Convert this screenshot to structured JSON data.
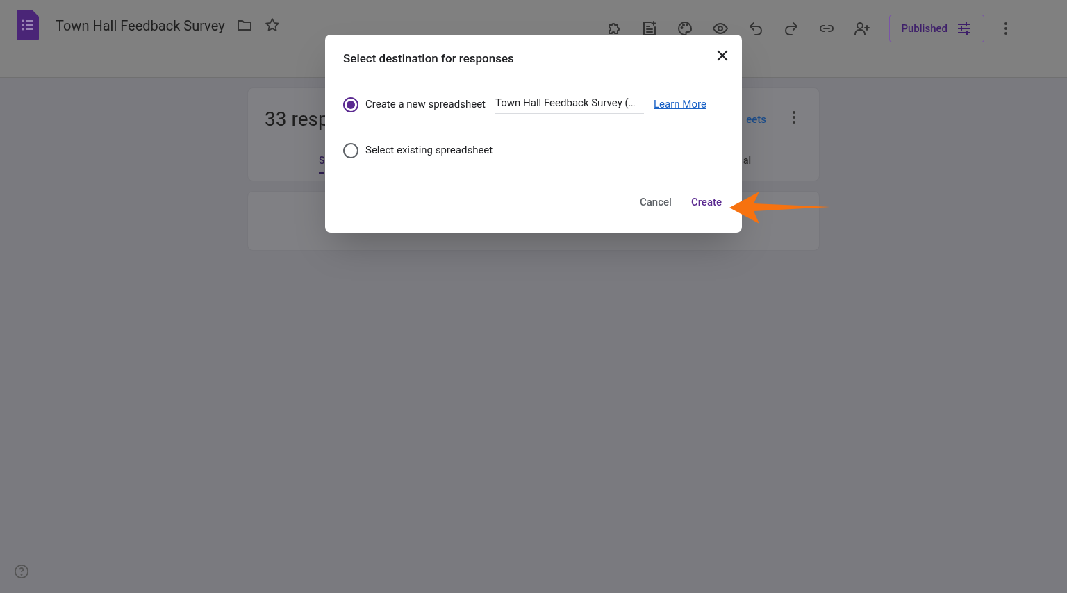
{
  "app": {
    "title": "Town Hall Feedback Survey",
    "publish_button": "Published"
  },
  "responses_card": {
    "count": "33 resp",
    "link": "eets",
    "tabs": [
      {
        "label": "S",
        "selected": true
      },
      {
        "label": "al",
        "selected": false
      }
    ]
  },
  "dialog": {
    "title": "Select destination for responses",
    "options": [
      {
        "label": "Create a new spreadsheet",
        "selected": true,
        "field_value": "Town Hall Feedback Survey (…",
        "link": "Learn More"
      },
      {
        "label": "Select existing spreadsheet",
        "selected": false
      }
    ],
    "buttons": [
      {
        "label": "Cancel",
        "kind": "secondary"
      },
      {
        "label": "Create",
        "kind": "primary"
      }
    ]
  }
}
